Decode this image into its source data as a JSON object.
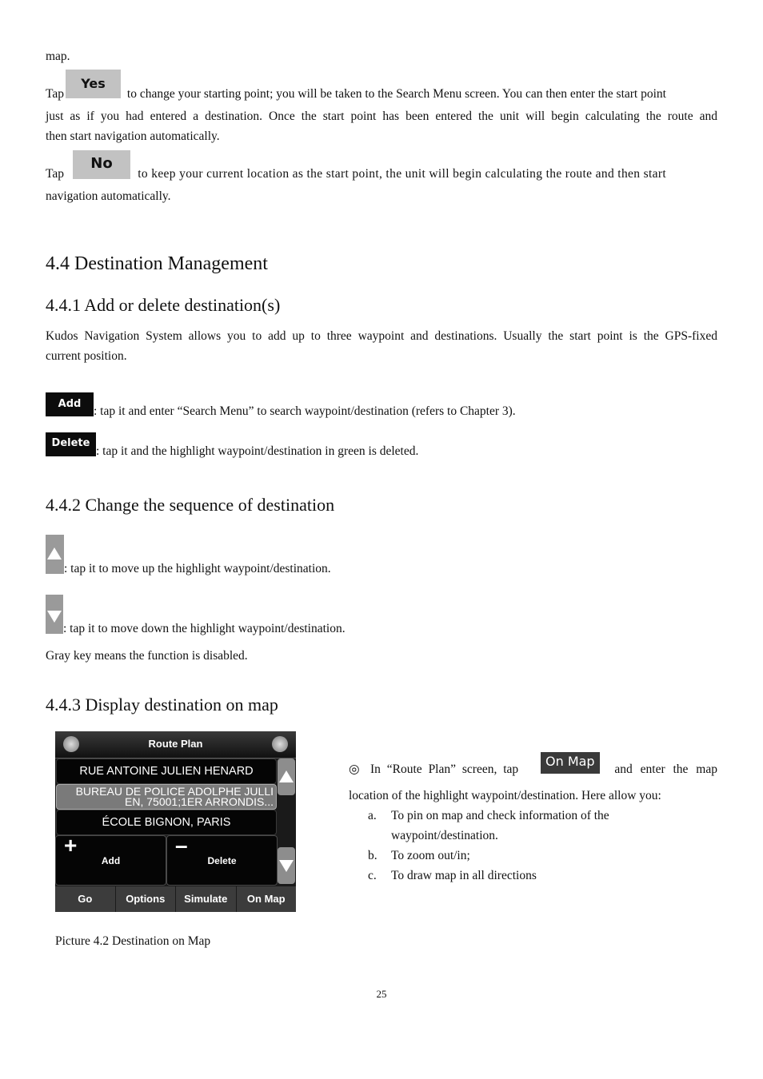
{
  "intro": {
    "fragment": "map.",
    "yes_para": {
      "prefix": "Tap",
      "button_label": "Yes",
      "line1": " to change your starting point; you will be taken to the Search Menu screen. You can then enter the start point",
      "line2": "just as if you had entered a destination. Once the start point has been entered the unit will begin calculating the route and",
      "line3": "then start navigation automatically."
    },
    "no_para": {
      "prefix": "Tap",
      "button_label": "No",
      "line1": " to keep your current location as the start point, the unit will begin calculating the route and then start",
      "line2": "navigation automatically."
    }
  },
  "section_4_4": {
    "title": "4.4 Destination Management"
  },
  "section_4_4_1": {
    "title": "4.4.1 Add or delete destination(s)",
    "body_line1": "Kudos Navigation System allows you to add up to three waypoint and destinations. Usually the start point is the GPS-fixed",
    "body_line2": "current position.",
    "add": {
      "button_label": "Add",
      "text": ": tap it and enter “Search Menu” to search waypoint/destination (refers to Chapter 3)."
    },
    "delete": {
      "button_label": "Delete",
      "text": ": tap it and the highlight waypoint/destination in green is deleted."
    }
  },
  "section_4_4_2": {
    "title": "4.4.2 Change the sequence of destination",
    "up_text": ": tap it to move up the highlight waypoint/destination.",
    "down_text": ": tap it to move down the highlight waypoint/destination.",
    "note": "Gray key means the function is disabled."
  },
  "section_4_4_3": {
    "title": "4.4.3 Display destination on map",
    "device": {
      "title": "Route Plan",
      "rows": [
        {
          "line1": "RUE ANTOINE JULIEN HENARD"
        },
        {
          "line1": "BUREAU DE POLICE ADOLPHE JULLI",
          "line2": "EN, 75001;1ER ARRONDIS..."
        },
        {
          "line1": "ÉCOLE BIGNON, PARIS"
        }
      ],
      "add_label": "Add",
      "delete_label": "Delete",
      "tabs": [
        "Go",
        "Options",
        "Simulate",
        "On Map"
      ]
    },
    "desc": {
      "bullet": "◎",
      "part1": "In “Route Plan” screen, tap",
      "button_label": "On Map",
      "part2": "and enter the map",
      "line2": "location of the highlight waypoint/destination. Here allow you:",
      "items": [
        {
          "marker": "a.",
          "line1": "To pin on map and check information of the",
          "line2": "waypoint/destination."
        },
        {
          "marker": "b.",
          "line1": "To zoom out/in;"
        },
        {
          "marker": "c.",
          "line1": "To draw map in all directions"
        }
      ]
    },
    "caption": "Picture 4.2 Destination on Map"
  },
  "page_number": "25"
}
